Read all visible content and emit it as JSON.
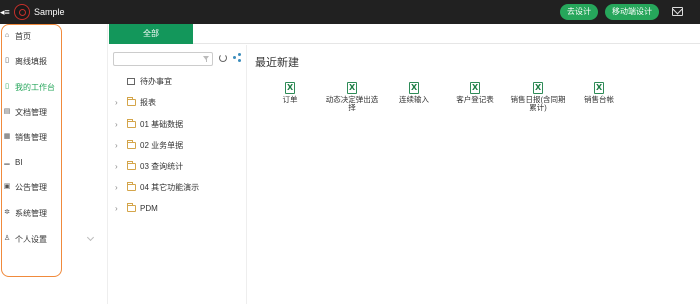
{
  "header": {
    "app_title": "Sample",
    "buttons": {
      "design": "去设计",
      "mobile_design": "移动端设计"
    },
    "icons": {
      "back": "back-arrow-icon",
      "logo": "app-logo",
      "mail": "mail-icon"
    }
  },
  "sidebar": {
    "items": [
      {
        "label": "首页",
        "icon": "home-icon"
      },
      {
        "label": "离线填报",
        "icon": "document-icon"
      },
      {
        "label": "我的工作台",
        "icon": "document-icon",
        "active": true
      },
      {
        "label": "文档管理",
        "icon": "folder-doc-icon"
      },
      {
        "label": "销售管理",
        "icon": "cart-icon"
      },
      {
        "label": "BI",
        "icon": "bar-chart-icon"
      },
      {
        "label": "公告管理",
        "icon": "notice-icon"
      },
      {
        "label": "系统管理",
        "icon": "gear-icon"
      },
      {
        "label": "个人设置",
        "icon": "user-icon"
      }
    ]
  },
  "tabs": {
    "all": "全部"
  },
  "tree": {
    "search_placeholder": "",
    "items": [
      {
        "label": "待办事宜",
        "type": "inbox"
      },
      {
        "label": "报表",
        "type": "folder"
      },
      {
        "label": "01 基础数据",
        "type": "folder"
      },
      {
        "label": "02 业务单据",
        "type": "folder"
      },
      {
        "label": "03 查询统计",
        "type": "folder"
      },
      {
        "label": "04 其它功能演示",
        "type": "folder"
      },
      {
        "label": "PDM",
        "type": "folder"
      }
    ]
  },
  "main": {
    "section_title": "最近新建",
    "quick_items": [
      {
        "label": "订单"
      },
      {
        "label": "动态决定弹出选择"
      },
      {
        "label": "连续输入"
      },
      {
        "label": "客户登记表"
      },
      {
        "label": "销售日报(含同期累计)"
      },
      {
        "label": "销售台帐"
      }
    ]
  },
  "colors": {
    "topbar": "#212121",
    "accent_green": "#26a65b",
    "tab_green": "#13975b",
    "highlight_orange": "#f08a3c",
    "folder": "#d4a54a"
  }
}
